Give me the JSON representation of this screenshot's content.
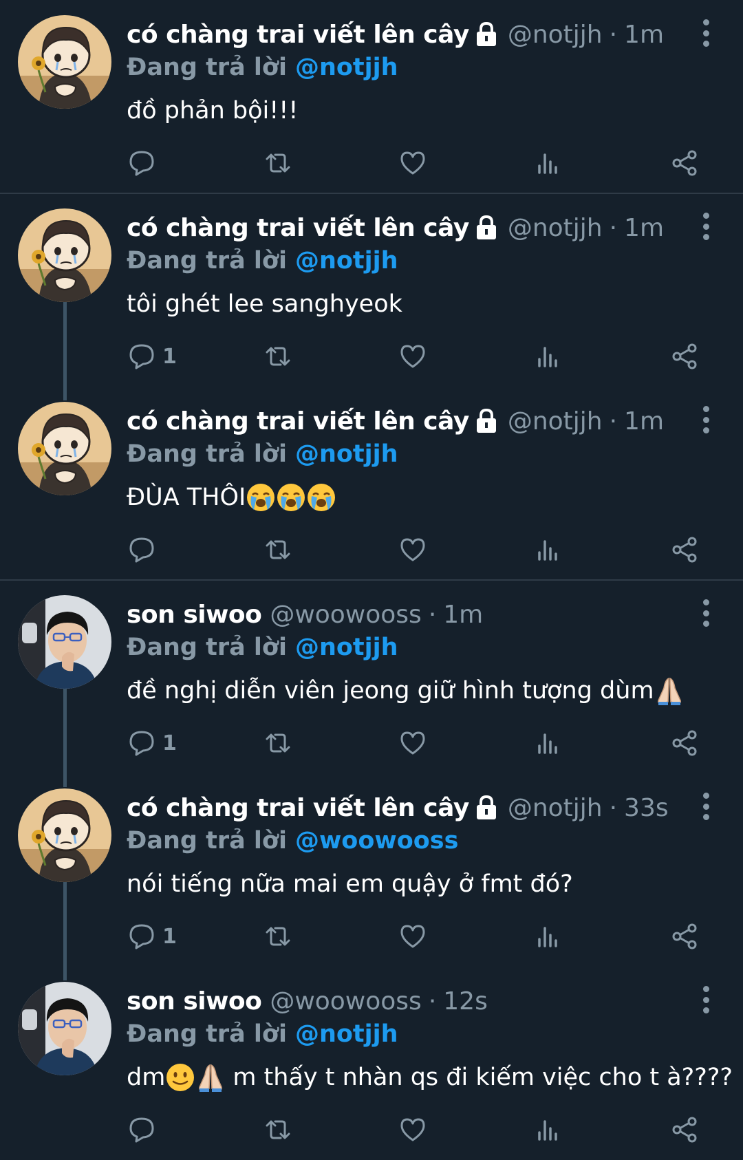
{
  "colors": {
    "background": "#15202b",
    "text_primary": "#ffffff",
    "text_secondary": "#8899a6",
    "accent": "#1d9bf0",
    "thread_line": "#3d5466",
    "divider": "#2f3b47"
  },
  "replying_label": "Đang trả lời",
  "tweets": [
    {
      "name": "có chàng trai viết lên cây",
      "protected": true,
      "handle": "@notjjh",
      "sep": "·",
      "time": "1m",
      "reply_to": "@notjjh",
      "text": "đồ phản bội!!!",
      "reply_count": "",
      "avatar": "cartoon"
    },
    {
      "name": "có chàng trai viết lên cây",
      "protected": true,
      "handle": "@notjjh",
      "sep": "·",
      "time": "1m",
      "reply_to": "@notjjh",
      "text": "tôi ghét lee sanghyeok",
      "reply_count": "1",
      "avatar": "cartoon"
    },
    {
      "name": "có chàng trai viết lên cây",
      "protected": true,
      "handle": "@notjjh",
      "sep": "·",
      "time": "1m",
      "reply_to": "@notjjh",
      "text": "ĐÙA THÔI",
      "text_emojis": [
        "crying-face",
        "crying-face",
        "crying-face"
      ],
      "reply_count": "",
      "avatar": "cartoon"
    },
    {
      "name": "son siwoo",
      "protected": false,
      "handle": "@woowooss",
      "sep": "·",
      "time": "1m",
      "reply_to": "@notjjh",
      "text": "đề nghị diễn viên jeong giữ hình tượng dùm",
      "text_emojis": [
        "folded-hands"
      ],
      "reply_count": "1",
      "avatar": "photo"
    },
    {
      "name": "có chàng trai viết lên cây",
      "protected": true,
      "handle": "@notjjh",
      "sep": "·",
      "time": "33s",
      "reply_to": "@woowooss",
      "text": "nói tiếng nữa mai em quậy ở fmt đó?",
      "reply_count": "1",
      "avatar": "cartoon"
    },
    {
      "name": "son siwoo",
      "protected": false,
      "handle": "@woowooss",
      "sep": "·",
      "time": "12s",
      "reply_to": "@notjjh",
      "text_prefix": "dm",
      "text_emojis": [
        "slightly-smiling-face",
        "folded-hands"
      ],
      "text": "m thấy t nhàn qs đi kiếm việc cho t à????",
      "reply_count": "",
      "avatar": "photo"
    }
  ],
  "icons": {
    "reply": "reply-icon",
    "retweet": "retweet-icon",
    "like": "heart-icon",
    "views": "analytics-icon",
    "share": "share-icon",
    "more": "more-dots-icon",
    "lock": "lock-icon"
  }
}
